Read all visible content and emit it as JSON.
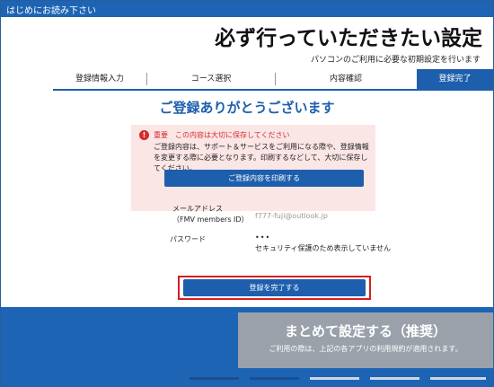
{
  "window": {
    "title": "はじめにお読み下さい"
  },
  "header": {
    "title": "必ず行っていただきたい設定",
    "subtitle": "パソコンのご利用に必要な初期設定を行います"
  },
  "steps": [
    {
      "label": "登録情報入力",
      "active": false
    },
    {
      "label": "コース選択",
      "active": false
    },
    {
      "label": "内容確認",
      "active": false
    },
    {
      "label": "登録完了",
      "active": true
    }
  ],
  "main": {
    "thanks": "ご登録ありがとうございます",
    "notice": {
      "heading": "重要　この内容は大切に保存してください",
      "body": "ご登録内容は、サポート＆サービスをご利用になる際や、登録情報を変更する際に必要となります。印刷するなどして、大切に保存してください。",
      "print_label": "ご登録内容を印刷する"
    },
    "email": {
      "label_line1": "メールアドレス",
      "label_line2": "（FMV members ID）",
      "value": "f777-fuji@outlook.jp"
    },
    "password": {
      "label": "パスワード",
      "value": "•••",
      "note": "セキュリティ保護のため表示していません"
    },
    "complete_label": "登録を完了する"
  },
  "bottom": {
    "recommend_title": "まとめて設定する（推奨）",
    "recommend_sub": "ご利用の際は、上記の各アプリの利用規約が適用されます。",
    "pages": [
      true,
      true,
      false,
      false,
      false
    ]
  },
  "colors": {
    "accent": "#1d5fad",
    "warning": "#d42a2a",
    "highlight": "#d71e1e"
  }
}
